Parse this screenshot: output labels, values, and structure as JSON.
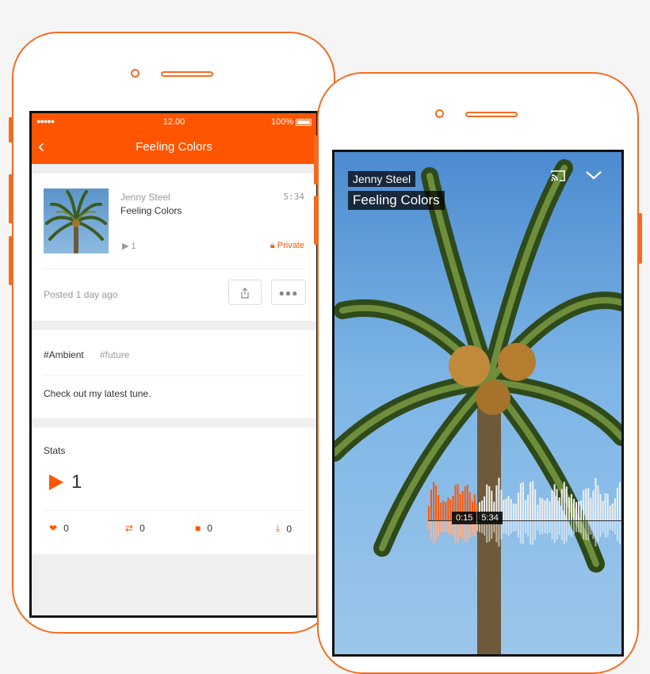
{
  "left_screen": {
    "status": {
      "signal": "●●●●● ",
      "time": "12.00",
      "battery": "100%"
    },
    "nav": {
      "title": "Feeling Colors"
    },
    "track": {
      "artist": "Jenny Steel",
      "title": "Feeling Colors",
      "duration": "5:34",
      "plays": "1",
      "privacy": "Private",
      "posted": "Posted 1 day ago"
    },
    "tags": {
      "main": "#Ambient",
      "secondary": "#future"
    },
    "description": "Check out my latest tune.",
    "stats": {
      "label": "Stats",
      "plays": "1",
      "likes": "0",
      "reposts": "0",
      "comments": "0",
      "downloads": "0"
    }
  },
  "right_screen": {
    "artist": "Jenny Steel",
    "title": "Feeling Colors",
    "current_time": "0:15",
    "total_time": "5:34",
    "progress_fraction": 0.045
  },
  "colors": {
    "accent": "#ff5500",
    "outline": "#f36c21"
  }
}
